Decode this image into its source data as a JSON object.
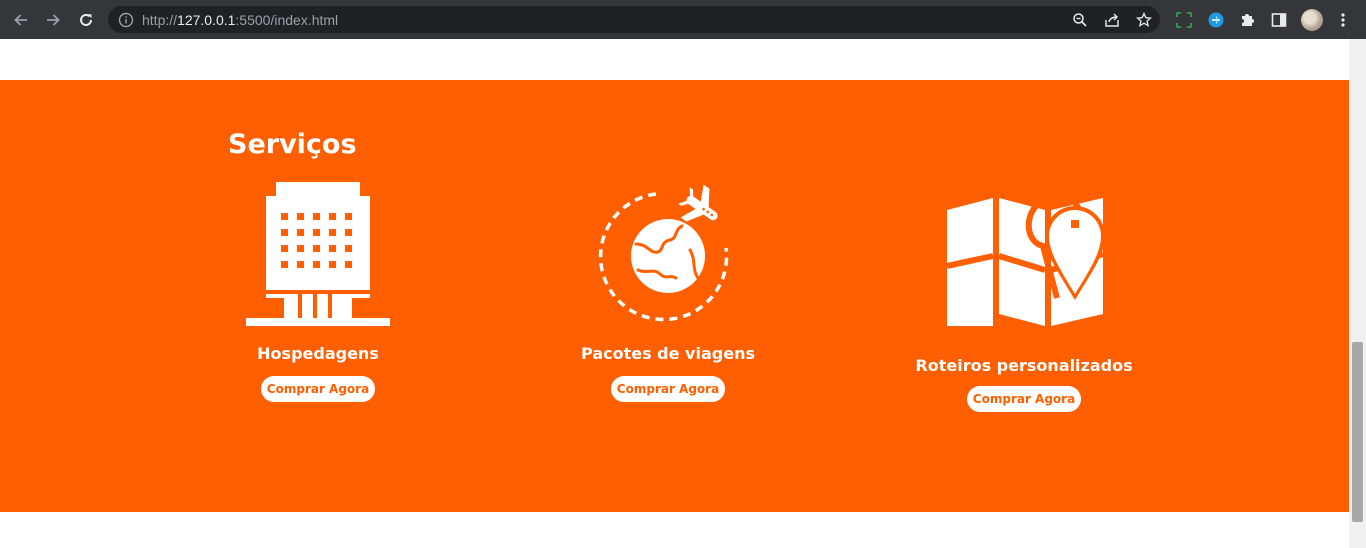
{
  "browser": {
    "url_scheme": "http://",
    "url_host": "127.0.0.1",
    "url_path": ":5500/index.html"
  },
  "page": {
    "services_title": "Serviços",
    "services": [
      {
        "title": "Hospedagens",
        "button_label": "Comprar Agora",
        "icon": "hotel-building-icon"
      },
      {
        "title": "Pacotes de viagens",
        "button_label": "Comprar Agora",
        "icon": "globe-airplane-icon"
      },
      {
        "title": "Roteiros personalizados",
        "button_label": "Comprar Agora",
        "icon": "map-pin-icon"
      }
    ]
  },
  "colors": {
    "accent": "#ff5f00",
    "toolbar": "#35363a",
    "omnibox": "#202124"
  }
}
